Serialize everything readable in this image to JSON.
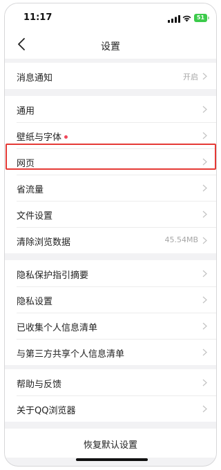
{
  "status_bar": {
    "time": "11:17",
    "battery": "51"
  },
  "nav": {
    "title": "设置"
  },
  "groups": [
    {
      "items": [
        {
          "label": "消息通知",
          "value": "开启"
        }
      ]
    },
    {
      "items": [
        {
          "label": "通用",
          "value": ""
        },
        {
          "label": "壁纸与字体",
          "value": "",
          "badge_color": "#f0485b"
        },
        {
          "label": "网页",
          "value": "",
          "highlighted": true
        },
        {
          "label": "省流量",
          "value": ""
        },
        {
          "label": "文件设置",
          "value": ""
        },
        {
          "label": "清除浏览数据",
          "value": "45.54MB"
        }
      ]
    },
    {
      "items": [
        {
          "label": "隐私保护指引摘要",
          "value": ""
        },
        {
          "label": "隐私设置",
          "value": ""
        },
        {
          "label": "已收集个人信息清单",
          "value": ""
        },
        {
          "label": "与第三方共享个人信息清单",
          "value": ""
        }
      ]
    },
    {
      "items": [
        {
          "label": "帮助与反馈",
          "value": ""
        },
        {
          "label": "关于QQ浏览器",
          "value": ""
        }
      ]
    }
  ],
  "reset": {
    "label": "恢复默认设置"
  },
  "colors": {
    "highlight": "#e53935",
    "background": "#f2f2f4",
    "accent_red": "#f0485b"
  },
  "icons": {
    "back": "chevron-left-icon",
    "row_arrow": "chevron-right-icon"
  }
}
